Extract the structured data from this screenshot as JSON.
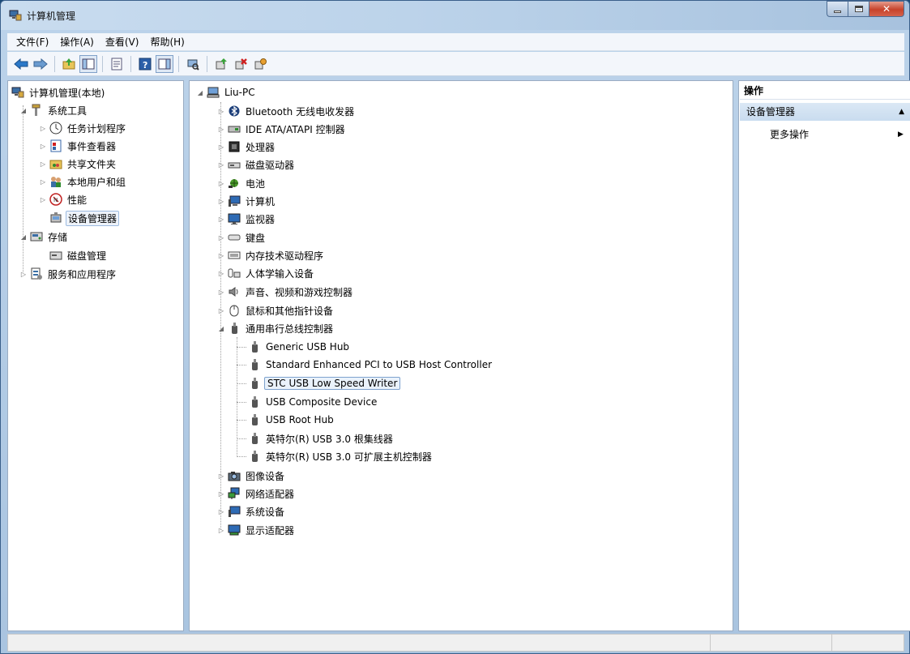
{
  "window": {
    "title": "计算机管理",
    "colors": {
      "titlebar": "#bcd3ea",
      "close_button": "#c7432b",
      "selection_border": "#7da2ce"
    }
  },
  "menubar": [
    "文件(F)",
    "操作(A)",
    "查看(V)",
    "帮助(H)"
  ],
  "toolbar": {
    "icons": [
      "back-icon",
      "forward-icon",
      "up-folder-icon",
      "show-tree-icon",
      "properties-icon",
      "help-icon",
      "show-action-pane-icon",
      "scan-hardware-icon",
      "update-driver-icon",
      "uninstall-icon",
      "disable-icon"
    ]
  },
  "left_tree": {
    "root": "计算机管理(本地)",
    "system_tools": "系统工具",
    "task_scheduler": "任务计划程序",
    "event_viewer": "事件查看器",
    "shared_folders": "共享文件夹",
    "local_users": "本地用户和组",
    "performance": "性能",
    "device_manager": "设备管理器",
    "storage": "存储",
    "disk_management": "磁盘管理",
    "services_apps": "服务和应用程序"
  },
  "device_tree": {
    "computer": "Liu-PC",
    "categories_top": [
      "Bluetooth 无线电收发器",
      "IDE ATA/ATAPI 控制器",
      "处理器",
      "磁盘驱动器",
      "电池",
      "计算机",
      "监视器",
      "键盘",
      "内存技术驱动程序",
      "人体学输入设备",
      "声音、视频和游戏控制器",
      "鼠标和其他指针设备"
    ],
    "usb_category": "通用串行总线控制器",
    "usb_devices": [
      "Generic USB Hub",
      "Standard Enhanced PCI to USB Host Controller",
      "STC USB Low Speed Writer",
      "USB Composite Device",
      "USB Root Hub",
      "英特尔(R) USB 3.0 根集线器",
      "英特尔(R) USB 3.0 可扩展主机控制器"
    ],
    "categories_bottom": [
      "图像设备",
      "网络适配器",
      "系统设备",
      "显示适配器"
    ]
  },
  "actions_pane": {
    "title": "操作",
    "section": "设备管理器",
    "more_actions": "更多操作"
  }
}
